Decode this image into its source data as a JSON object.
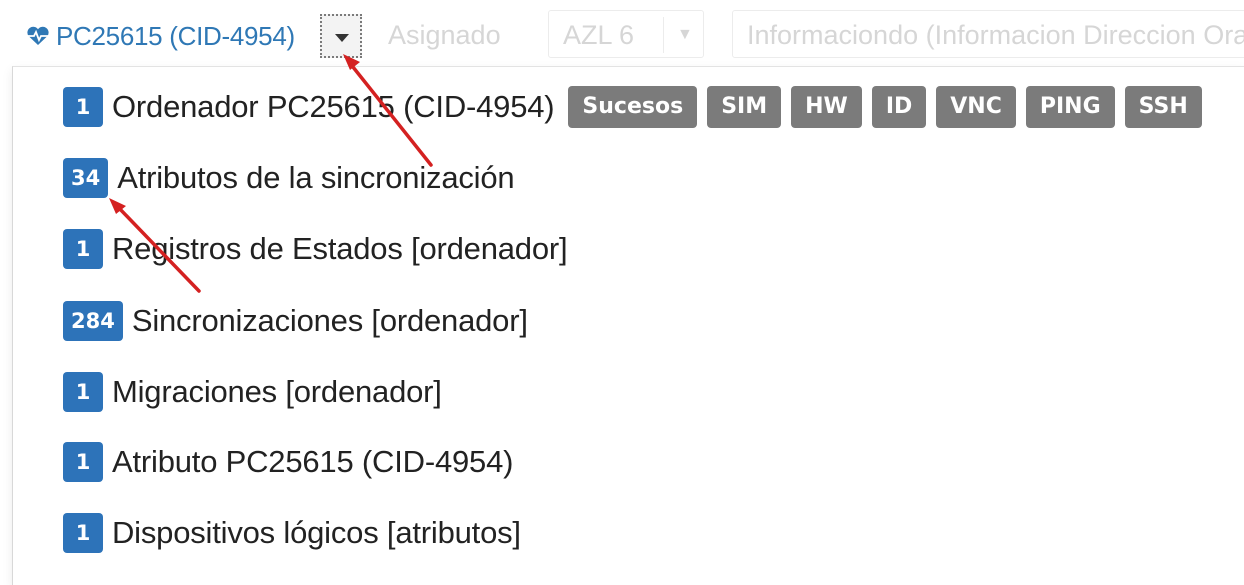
{
  "host": {
    "icon": "heartbeat-icon",
    "label": "PC25615 (CID-4954)"
  },
  "background": {
    "assigned_label": "Asignado",
    "group_select_value": "AZL 6",
    "info_value": "Informaciondo (Informacion Direccion Ora"
  },
  "menu": {
    "items": [
      {
        "count": "1",
        "label": "Ordenador PC25615 (CID-4954)"
      },
      {
        "count": "34",
        "label": "Atributos de la sincronización"
      },
      {
        "count": "1",
        "label": "Registros de Estados [ordenador]"
      },
      {
        "count": "284",
        "label": "Sincronizaciones [ordenador]"
      },
      {
        "count": "1",
        "label": "Migraciones [ordenador]"
      },
      {
        "count": "1",
        "label": "Atributo PC25615 (CID-4954)"
      },
      {
        "count": "1",
        "label": "Dispositivos lógicos [atributos]"
      }
    ],
    "tools": [
      "Sucesos",
      "SIM",
      "HW",
      "ID",
      "VNC",
      "PING",
      "SSH"
    ]
  },
  "colors": {
    "badge": "#2d73b9",
    "tool_button": "#7b7b7b",
    "host_text": "#2f78b5",
    "annotation_arrow": "#d42121"
  }
}
